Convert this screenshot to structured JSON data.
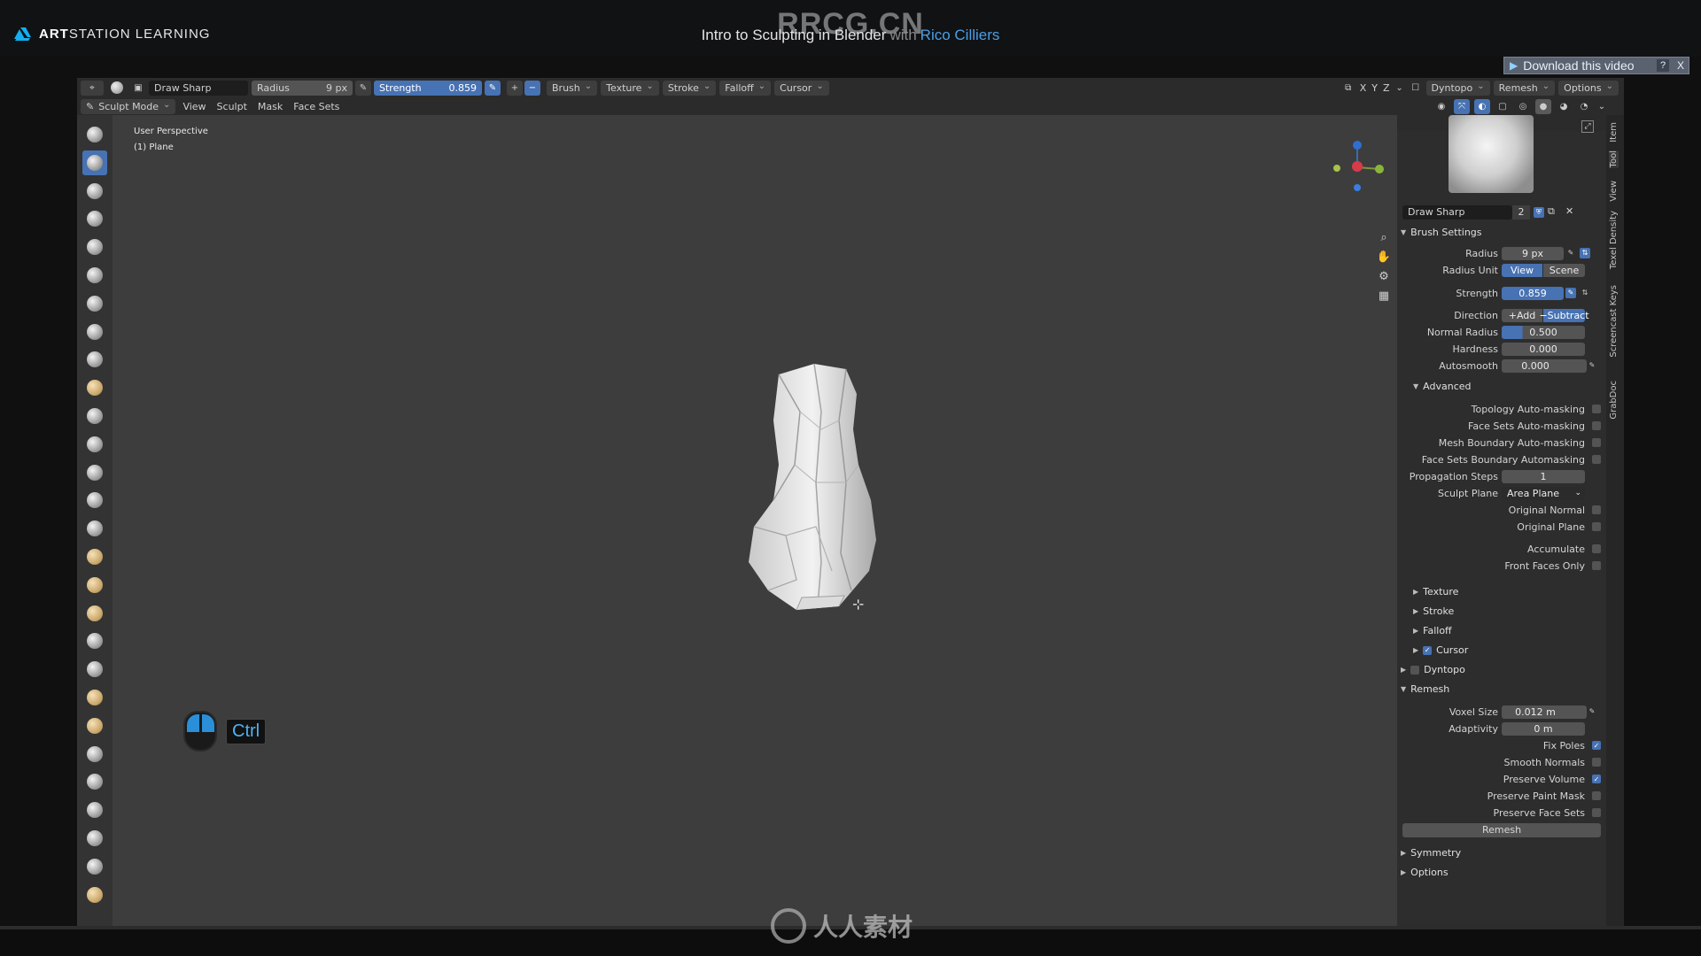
{
  "banner": {
    "brand_bold": "ART",
    "brand_rest": "STATION LEARNING",
    "course_title": "Intro to Sculpting in Blender",
    "with": "with",
    "author": "Rico Cilliers",
    "watermark_top": "RRCG.CN",
    "download": "Download this video",
    "help": "?",
    "close": "X"
  },
  "header": {
    "brush_name": "Draw Sharp",
    "radius_label": "Radius",
    "radius_value": "9 px",
    "strength_label": "Strength",
    "strength_value": "0.859",
    "menus": [
      "Brush",
      "Texture",
      "Stroke",
      "Falloff",
      "Cursor"
    ],
    "axis": [
      "X",
      "Y",
      "Z"
    ],
    "right_menus": [
      "Dyntopo",
      "Remesh",
      "Options"
    ]
  },
  "header2": {
    "mode": "Sculpt Mode",
    "menus": [
      "View",
      "Sculpt",
      "Mask",
      "Face Sets"
    ]
  },
  "viewport": {
    "perspective": "User Perspective",
    "object": "(1) Plane"
  },
  "overlay_key": "Ctrl",
  "panel": {
    "brush_name": "Draw Sharp",
    "brush_users": "2",
    "brush_settings": "Brush Settings",
    "radius_label": "Radius",
    "radius_value": "9 px",
    "radius_unit_label": "Radius Unit",
    "radius_unit_view": "View",
    "radius_unit_scene": "Scene",
    "strength_label": "Strength",
    "strength_value": "0.859",
    "direction_label": "Direction",
    "direction_add": "Add",
    "direction_subtract": "Subtract",
    "normal_radius_label": "Normal Radius",
    "normal_radius_value": "0.500",
    "hardness_label": "Hardness",
    "hardness_value": "0.000",
    "autosmooth_label": "Autosmooth",
    "autosmooth_value": "0.000",
    "advanced": "Advanced",
    "topology_automasking": "Topology Auto-masking",
    "facesets_automasking": "Face Sets Auto-masking",
    "meshboundary_automasking": "Mesh Boundary Auto-masking",
    "facesetsboundary_automasking": "Face Sets Boundary Automasking",
    "propagation_label": "Propagation Steps",
    "propagation_value": "1",
    "sculpt_plane_label": "Sculpt Plane",
    "sculpt_plane_value": "Area Plane",
    "original_normal": "Original Normal",
    "original_plane": "Original Plane",
    "accumulate": "Accumulate",
    "front_faces_only": "Front Faces Only",
    "texture": "Texture",
    "stroke": "Stroke",
    "falloff": "Falloff",
    "cursor": "Cursor",
    "dyntopo": "Dyntopo",
    "remesh": "Remesh",
    "voxel_size_label": "Voxel Size",
    "voxel_size_value": "0.012 m",
    "adaptivity_label": "Adaptivity",
    "adaptivity_value": "0 m",
    "fix_poles": "Fix Poles",
    "smooth_normals": "Smooth Normals",
    "preserve_volume": "Preserve Volume",
    "preserve_paint_mask": "Preserve Paint Mask",
    "preserve_face_sets": "Preserve Face Sets",
    "remesh_button": "Remesh",
    "symmetry": "Symmetry",
    "options": "Options"
  },
  "tabs": [
    "Item",
    "Tool",
    "View",
    "Texel Density",
    "Screencast Keys",
    "GrabDoc"
  ],
  "watermark_bottom": "人人素材",
  "colors": {
    "accent": "#4772b3",
    "author_link": "#4a9fe6",
    "key_blue": "#2a8fd8"
  }
}
